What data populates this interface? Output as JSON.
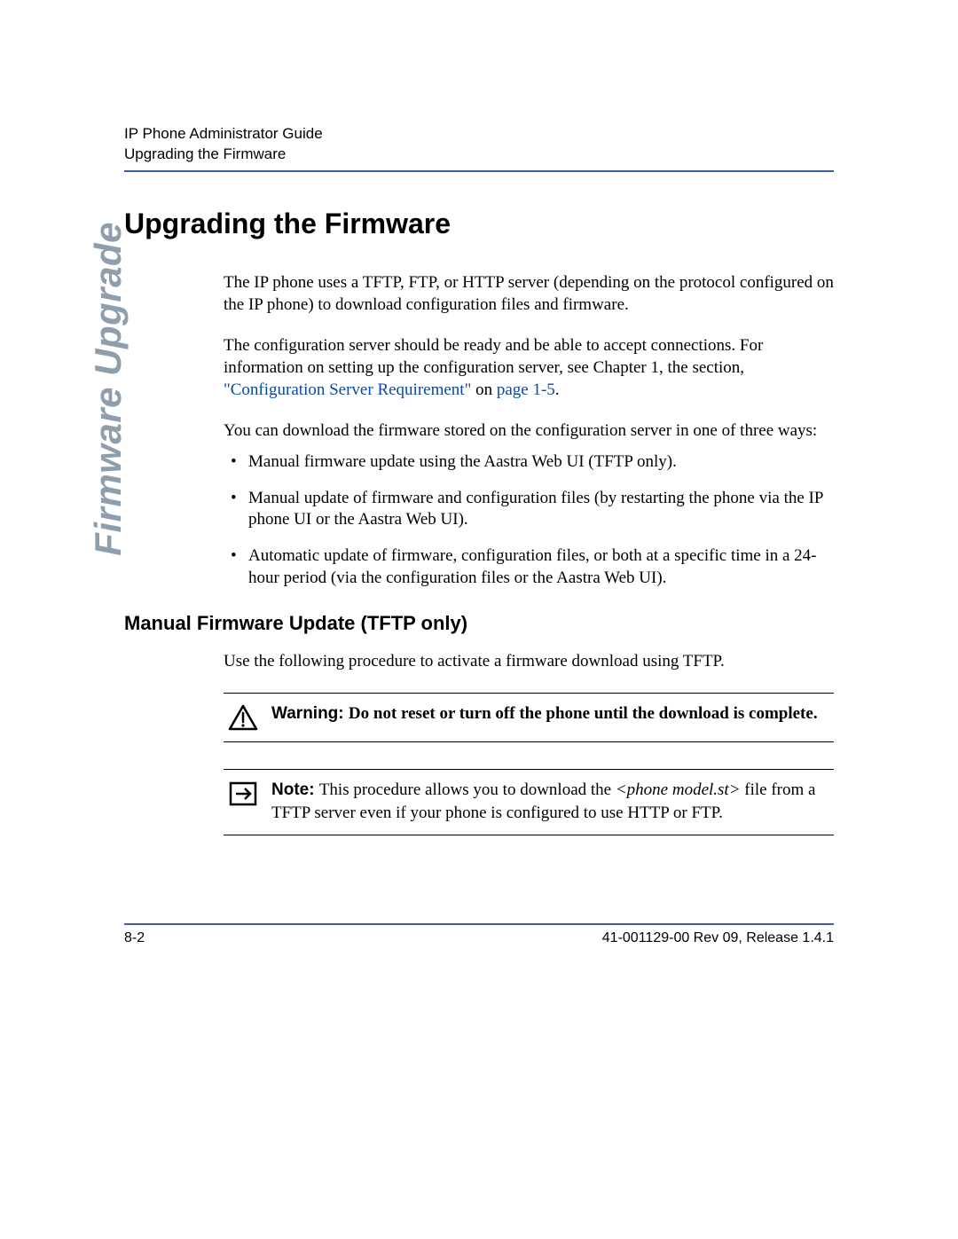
{
  "header": {
    "line1": "IP Phone Administrator Guide",
    "line2": "Upgrading the Firmware"
  },
  "side_tab": "Firmware Upgrade",
  "h1": "Upgrading the Firmware",
  "intro_p1": "The IP phone uses a TFTP, FTP, or HTTP server (depending on the protocol configured on the IP phone) to download configuration files and firmware.",
  "intro_p2_pre": "The configuration server should be ready and be able to accept connections. For information on setting up the configuration server, see Chapter 1, the section, ",
  "intro_p2_link1": "\"Configuration Server Requirement\"",
  "intro_p2_mid": " on ",
  "intro_p2_link2": "page 1-5",
  "intro_p2_post": ".",
  "intro_p3": "You can download the firmware stored on the configuration server in one of three ways:",
  "bullets": [
    "Manual firmware update using the Aastra Web UI (TFTP only).",
    "Manual update of firmware and configuration files (by restarting the phone via the IP phone UI or the Aastra Web UI).",
    "Automatic update of firmware, configuration files, or both at a specific time in a 24-hour period (via the configuration files or the Aastra Web UI)."
  ],
  "h2": "Manual Firmware Update (TFTP only)",
  "proc_p": "Use the following procedure to activate a firmware download using TFTP.",
  "warning": {
    "label": "Warning: ",
    "text": "Do not reset or turn off the phone until the download is complete."
  },
  "note": {
    "label": "Note: ",
    "pre": "This procedure allows you to download the ",
    "italic": "<phone model.st>",
    "post": " file from a TFTP server even if your phone is configured to use HTTP or FTP."
  },
  "footer": {
    "left": "8-2",
    "right": "41-001129-00 Rev 09, Release 1.4.1"
  }
}
